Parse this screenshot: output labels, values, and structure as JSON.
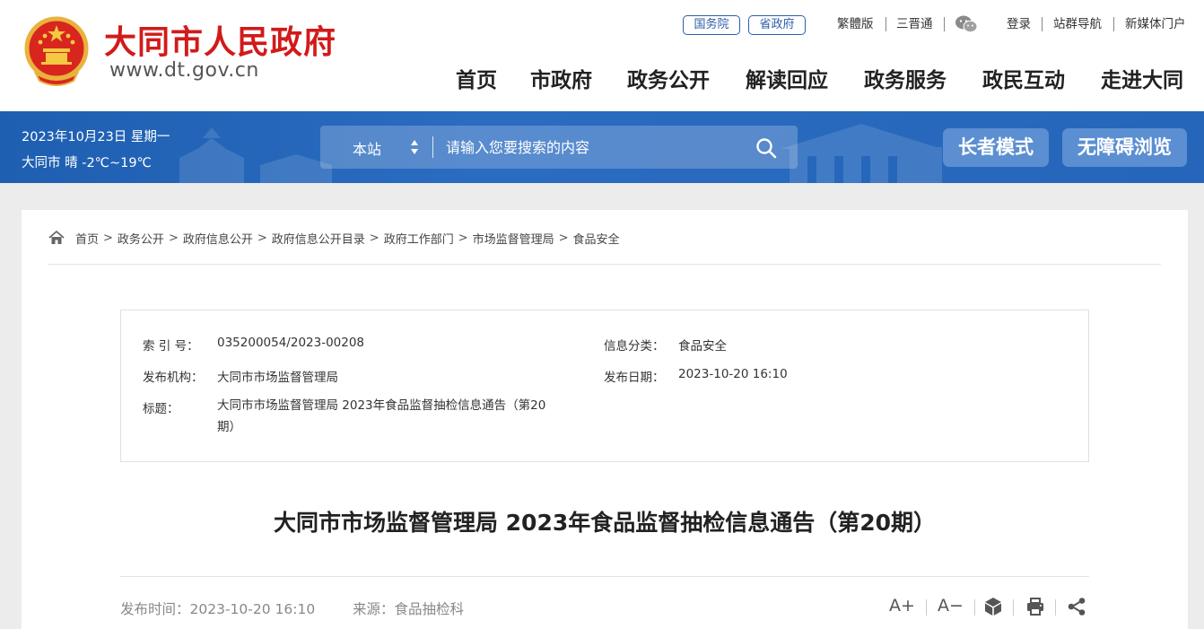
{
  "header": {
    "site_name": "大同市人民政府",
    "site_domain": "www.dt.gov.cn",
    "pills": [
      "国务院",
      "省政府"
    ],
    "top_links": {
      "traditional": "繁體版",
      "sanjintong": "三晋通",
      "login": "登录",
      "site_nav": "站群导航",
      "new_media": "新媒体门户"
    },
    "nav": [
      "首页",
      "市政府",
      "政务公开",
      "解读回应",
      "政务服务",
      "政民互动",
      "走进大同"
    ]
  },
  "banner": {
    "date": "2023年10月23日 星期一",
    "weather": "大同市 晴 -2℃~19℃",
    "search": {
      "scope": "本站",
      "placeholder": "请输入您要搜索的内容"
    },
    "elder_mode": "长者模式",
    "accessible_mode": "无障碍浏览"
  },
  "breadcrumb": [
    "首页",
    "政务公开",
    "政府信息公开",
    "政府信息公开目录",
    "政府工作部门",
    "市场监督管理局",
    "食品安全"
  ],
  "meta": {
    "index_label": "索 引 号：",
    "index_value": "035200054/2023-00208",
    "category_label": "信息分类：",
    "category_value": "食品安全",
    "publisher_label": "发布机构：",
    "publisher_value": "大同市市场监督管理局",
    "date_label": "发布日期：",
    "date_value": "2023-10-20 16:10",
    "title_label": "标题：",
    "title_value": "大同市市场监督管理局 2023年食品监督抽检信息通告（第20期）"
  },
  "article": {
    "title": "大同市市场监督管理局 2023年食品监督抽检信息通告（第20期）",
    "publish_time": "发布时间：2023-10-20 16:10",
    "source": "来源：食品抽检科",
    "tools": {
      "font_larger": "A+",
      "font_smaller": "A−"
    }
  },
  "colors": {
    "brand_red": "#d21a1a",
    "banner_blue": "#2666ba",
    "link_blue": "#2c5ea8"
  }
}
